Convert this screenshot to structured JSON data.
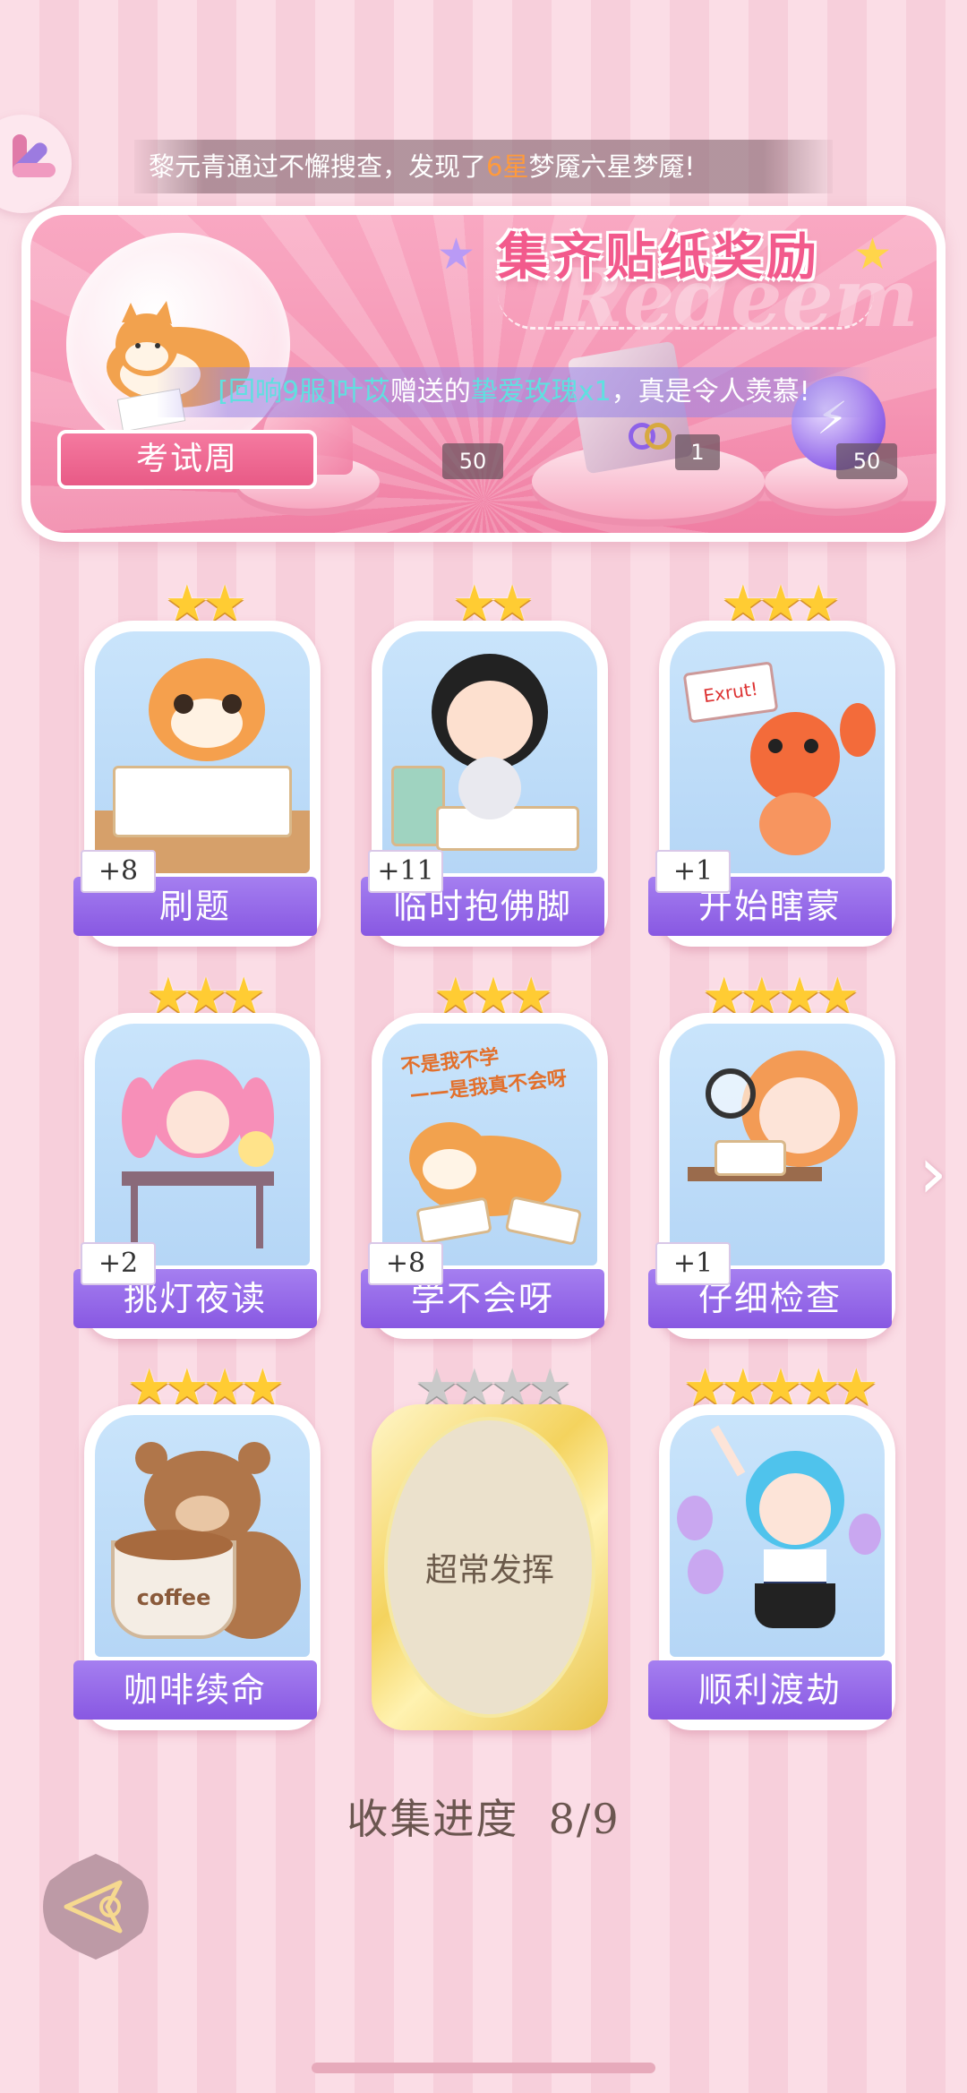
{
  "ticker": {
    "prefix": "黎元青通过不懈搜查，发现了",
    "highlight": "6星",
    "suffix": "梦魇六星梦魇!"
  },
  "banner": {
    "title": "集齐贴纸奖励",
    "watermark": "Redeem",
    "week_label": "考试周",
    "gift_message": {
      "sender": "[回响9服]叶苡",
      "mid": "赠送的",
      "item": "挚爱玫瑰x1",
      "suffix": "，真是令人羡慕!"
    },
    "rewards": [
      {
        "icon": "heart-gem-icon",
        "qty": "50"
      },
      {
        "icon": "gift-box-icon",
        "qty": "1"
      },
      {
        "icon": "energy-orb-icon",
        "qty": "50"
      }
    ]
  },
  "stickers": [
    {
      "name": "刷题",
      "stars": "★★",
      "count": "+8"
    },
    {
      "name": "临时抱佛脚",
      "stars": "★★",
      "count": "+11"
    },
    {
      "name": "开始瞎蒙",
      "stars": "★★★",
      "count": "+1"
    },
    {
      "name": "挑灯夜读",
      "stars": "★★★",
      "count": "+2"
    },
    {
      "name": "学不会呀",
      "stars": "★★★",
      "count": "+8"
    },
    {
      "name": "仔细检查",
      "stars": "★★★★",
      "count": "+1"
    },
    {
      "name": "咖啡续命",
      "stars": "★★★★"
    },
    {
      "name": "超常发挥",
      "stars": "★★★★",
      "locked": true
    },
    {
      "name": "顺利渡劫",
      "stars": "★★★★★"
    }
  ],
  "sticker_art_text": {
    "lobster_sign": "Exrut!",
    "shiba_caption_1": "不是我不学",
    "shiba_caption_2": "——是我真不会呀",
    "coffee_cup": "coffee"
  },
  "progress": {
    "label": "收集进度",
    "value": "8/9"
  },
  "colors": {
    "accent_purple": "#8858e2",
    "title_pink": "#f25a8c",
    "star_gold": "#ffcc33"
  }
}
